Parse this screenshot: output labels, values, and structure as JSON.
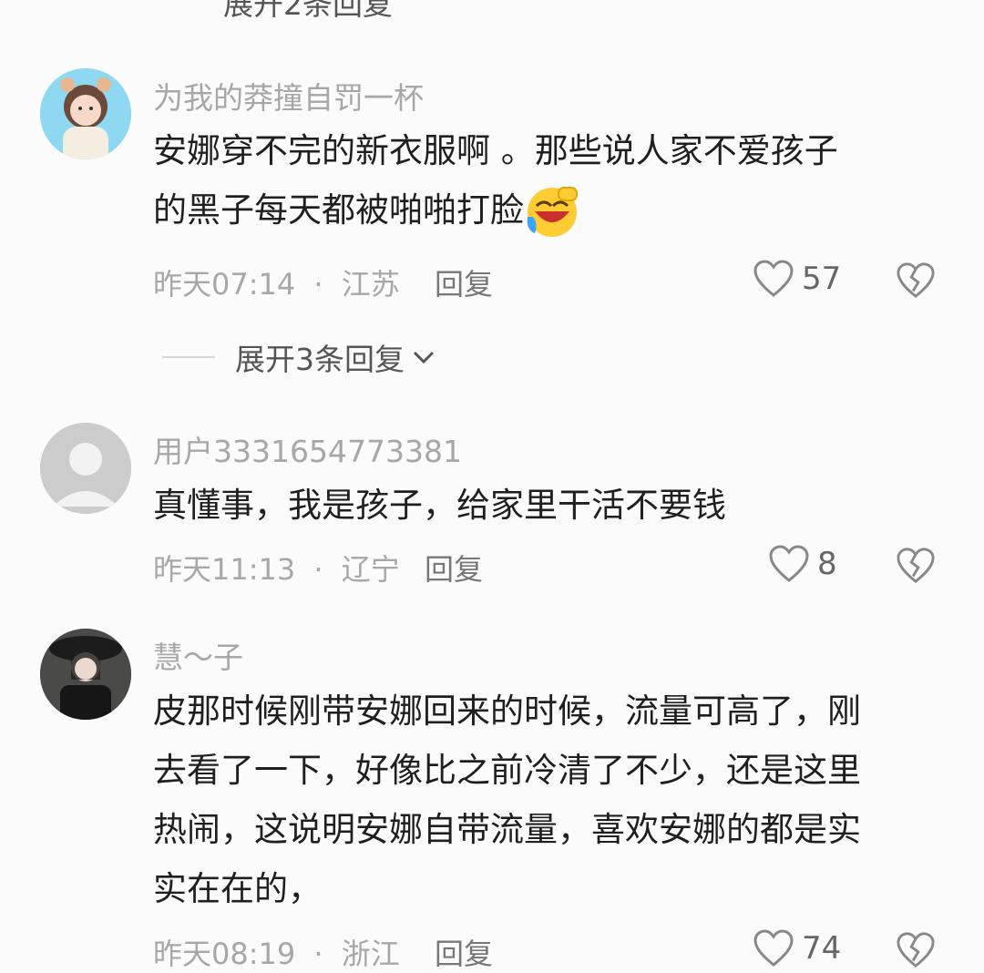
{
  "top_expand": {
    "label": "展开2条回复"
  },
  "comments": [
    {
      "user": "为我的莽撞自罚一杯",
      "text": "安娜穿不完的新衣服啊 。那些说人家不爱孩子的黑子每天都被啪啪打脸",
      "text_line1": "安娜穿不完的新衣服啊 。那些说人家不爱孩子",
      "text_line2": "的黑子每天都被啪啪打脸",
      "emoji": "laughing-crying-face-icon",
      "time": "昨天07:14",
      "sep": "·",
      "location": "江苏",
      "reply_label": "回复",
      "likes": "57",
      "expand": "展开3条回复"
    },
    {
      "user": "用户3331654773381",
      "text": "真懂事，我是孩子，给家里干活不要钱",
      "time": "昨天11:13",
      "sep": "·",
      "location": "辽宁",
      "reply_label": "回复",
      "likes": "8"
    },
    {
      "user": "慧～子",
      "text": "皮那时候刚带安娜回来的时候，流量可高了，刚去看了一下，好像比之前冷清了不少，还是这里热闹，这说明安娜自带流量，喜欢安娜的都是实实在在的，",
      "lines": [
        "皮那时候刚带安娜回来的时候，流量可高了，刚",
        "去看了一下，好像比之前冷清了不少，还是这里",
        "热闹，这说明安娜自带流量，喜欢安娜的都是实",
        "实在在的，"
      ],
      "time": "昨天08:19",
      "sep": "·",
      "location": "浙江",
      "reply_label": "回复",
      "likes": "74"
    }
  ],
  "colors": {
    "meta": "#a7a7aa",
    "text": "#1f1f1f",
    "background": "#fbfbfb"
  }
}
